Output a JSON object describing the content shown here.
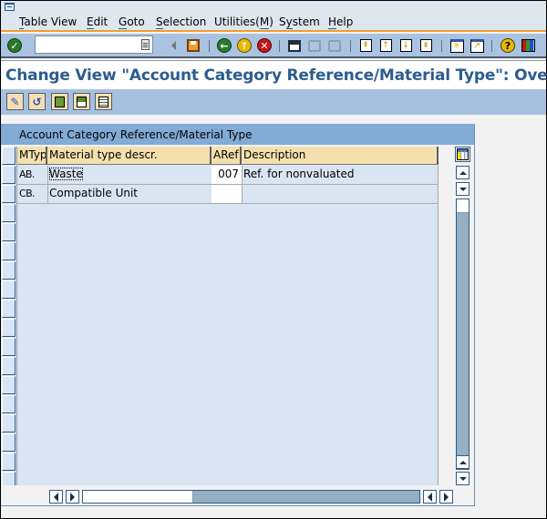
{
  "window": {
    "menu": [
      {
        "label": "Table View",
        "mnemonic": "T"
      },
      {
        "label": "Edit",
        "mnemonic": "E"
      },
      {
        "label": "Goto",
        "mnemonic": "G"
      },
      {
        "label": "Selection",
        "mnemonic": "S"
      },
      {
        "label": "Utilities(M)",
        "mnemonic": "M"
      },
      {
        "label": "System",
        "mnemonic": "y"
      },
      {
        "label": "Help",
        "mnemonic": "H"
      }
    ],
    "command_field": {
      "value": "",
      "placeholder": ""
    }
  },
  "toolbar": {
    "icons": [
      "enter-icon",
      "back-nav-icon",
      "save-icon",
      "back-icon",
      "exit-icon",
      "cancel-icon",
      "print-icon",
      "find-icon",
      "find-next-icon",
      "first-page-icon",
      "previous-page-icon",
      "next-page-icon",
      "last-page-icon",
      "create-session-icon",
      "shortcut-icon",
      "help-icon",
      "layout-icon"
    ]
  },
  "page": {
    "title": "Change View \"Account Category Reference/Material Type\": Overview"
  },
  "app_toolbar": {
    "buttons": [
      "display-change-icon",
      "undo-change-icon",
      "select-all-icon",
      "select-block-icon",
      "deselect-all-icon"
    ]
  },
  "table": {
    "title": "Account Category Reference/Material Type",
    "columns": [
      {
        "key": "mtyp",
        "label": "MTyp"
      },
      {
        "key": "mtdesc",
        "label": "Material type descr."
      },
      {
        "key": "aref",
        "label": "ARef"
      },
      {
        "key": "desc",
        "label": "Description"
      }
    ],
    "rows": [
      {
        "mtyp": "AB.",
        "mtdesc": "Waste",
        "aref": "007",
        "desc": "Ref. for nonvaluated"
      },
      {
        "mtyp": "CB.",
        "mtdesc": "Compatible Unit",
        "aref": "",
        "desc": ""
      }
    ],
    "visible_row_slots": 18
  },
  "colors": {
    "title_text": "#2c5d8f",
    "menu_accent": "#f0a028",
    "toolbar_bg": "#a9c3e0",
    "table_title_bg": "#82abd6",
    "header_bg": "#f4e0ae",
    "grid_bg": "#dae5f3"
  }
}
